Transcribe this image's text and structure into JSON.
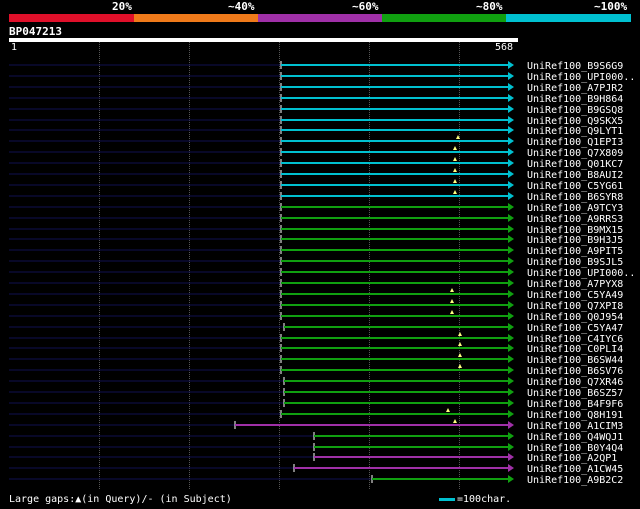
{
  "legend": {
    "labels": [
      "20%",
      "~40%",
      "~60%",
      "~80%",
      "~100%"
    ],
    "colors": [
      "#e0102a",
      "#ef7a1a",
      "#a030a8",
      "#10a010",
      "#00c0d0"
    ]
  },
  "query": {
    "title": "BP047213",
    "start": "1",
    "end": "568"
  },
  "footer": {
    "gaps_text": "Large gaps:▲(in Query)/- (in Subject)",
    "scale_text": "=100char."
  },
  "hits": [
    {
      "label": "UniRef100_B9S6G9",
      "color": "#00c0d0"
    },
    {
      "label": "UniRef100_UPI000..",
      "color": "#00c0d0"
    },
    {
      "label": "UniRef100_A7PJR2",
      "color": "#00c0d0"
    },
    {
      "label": "UniRef100_B9H864",
      "color": "#00c0d0"
    },
    {
      "label": "UniRef100_B9GSQ8",
      "color": "#00c0d0"
    },
    {
      "label": "UniRef100_Q9SKX5",
      "color": "#00c0d0"
    },
    {
      "label": "UniRef100_Q9LYT1",
      "color": "#00c0d0"
    },
    {
      "label": "UniRef100_Q1EPI3",
      "color": "#00c0d0"
    },
    {
      "label": "UniRef100_Q7X809",
      "color": "#00c0d0"
    },
    {
      "label": "UniRef100_Q01KC7",
      "color": "#00c0d0"
    },
    {
      "label": "UniRef100_B8AUI2",
      "color": "#00c0d0"
    },
    {
      "label": "UniRef100_C5YG61",
      "color": "#00c0d0"
    },
    {
      "label": "UniRef100_B6SYR8",
      "color": "#00c0d0"
    },
    {
      "label": "UniRef100_A9TCY3",
      "color": "#10a010"
    },
    {
      "label": "UniRef100_A9RRS3",
      "color": "#10a010"
    },
    {
      "label": "UniRef100_B9MX15",
      "color": "#10a010"
    },
    {
      "label": "UniRef100_B9H3J5",
      "color": "#10a010"
    },
    {
      "label": "UniRef100_A9PIT5",
      "color": "#10a010"
    },
    {
      "label": "UniRef100_B9SJL5",
      "color": "#10a010"
    },
    {
      "label": "UniRef100_UPI000..",
      "color": "#10a010"
    },
    {
      "label": "UniRef100_A7PYX8",
      "color": "#10a010"
    },
    {
      "label": "UniRef100_C5YA49",
      "color": "#10a010"
    },
    {
      "label": "UniRef100_Q7XPI8",
      "color": "#10a010"
    },
    {
      "label": "UniRef100_Q0J954",
      "color": "#10a010"
    },
    {
      "label": "UniRef100_C5YA47",
      "color": "#10a010"
    },
    {
      "label": "UniRef100_C4IYC6",
      "color": "#10a010"
    },
    {
      "label": "UniRef100_C0PLI4",
      "color": "#10a010"
    },
    {
      "label": "UniRef100_B6SW44",
      "color": "#10a010"
    },
    {
      "label": "UniRef100_B6SV76",
      "color": "#10a010"
    },
    {
      "label": "UniRef100_Q7XR46",
      "color": "#10a010"
    },
    {
      "label": "UniRef100_B6SZ57",
      "color": "#10a010"
    },
    {
      "label": "UniRef100_B4F9F6",
      "color": "#10a010"
    },
    {
      "label": "UniRef100_Q8H191",
      "color": "#10a010"
    },
    {
      "label": "UniRef100_A1CIM3",
      "color": "#a030a8"
    },
    {
      "label": "UniRef100_Q4WQJ1",
      "color": "#10a010"
    },
    {
      "label": "UniRef100_B0Y4Q4",
      "color": "#10a010"
    },
    {
      "label": "UniRef100_A2QP1",
      "color": "#a030a8"
    },
    {
      "label": "UniRef100_A1CW45",
      "color": "#a030a8"
    },
    {
      "label": "UniRef100_A9B2C2",
      "color": "#10a010"
    }
  ]
}
